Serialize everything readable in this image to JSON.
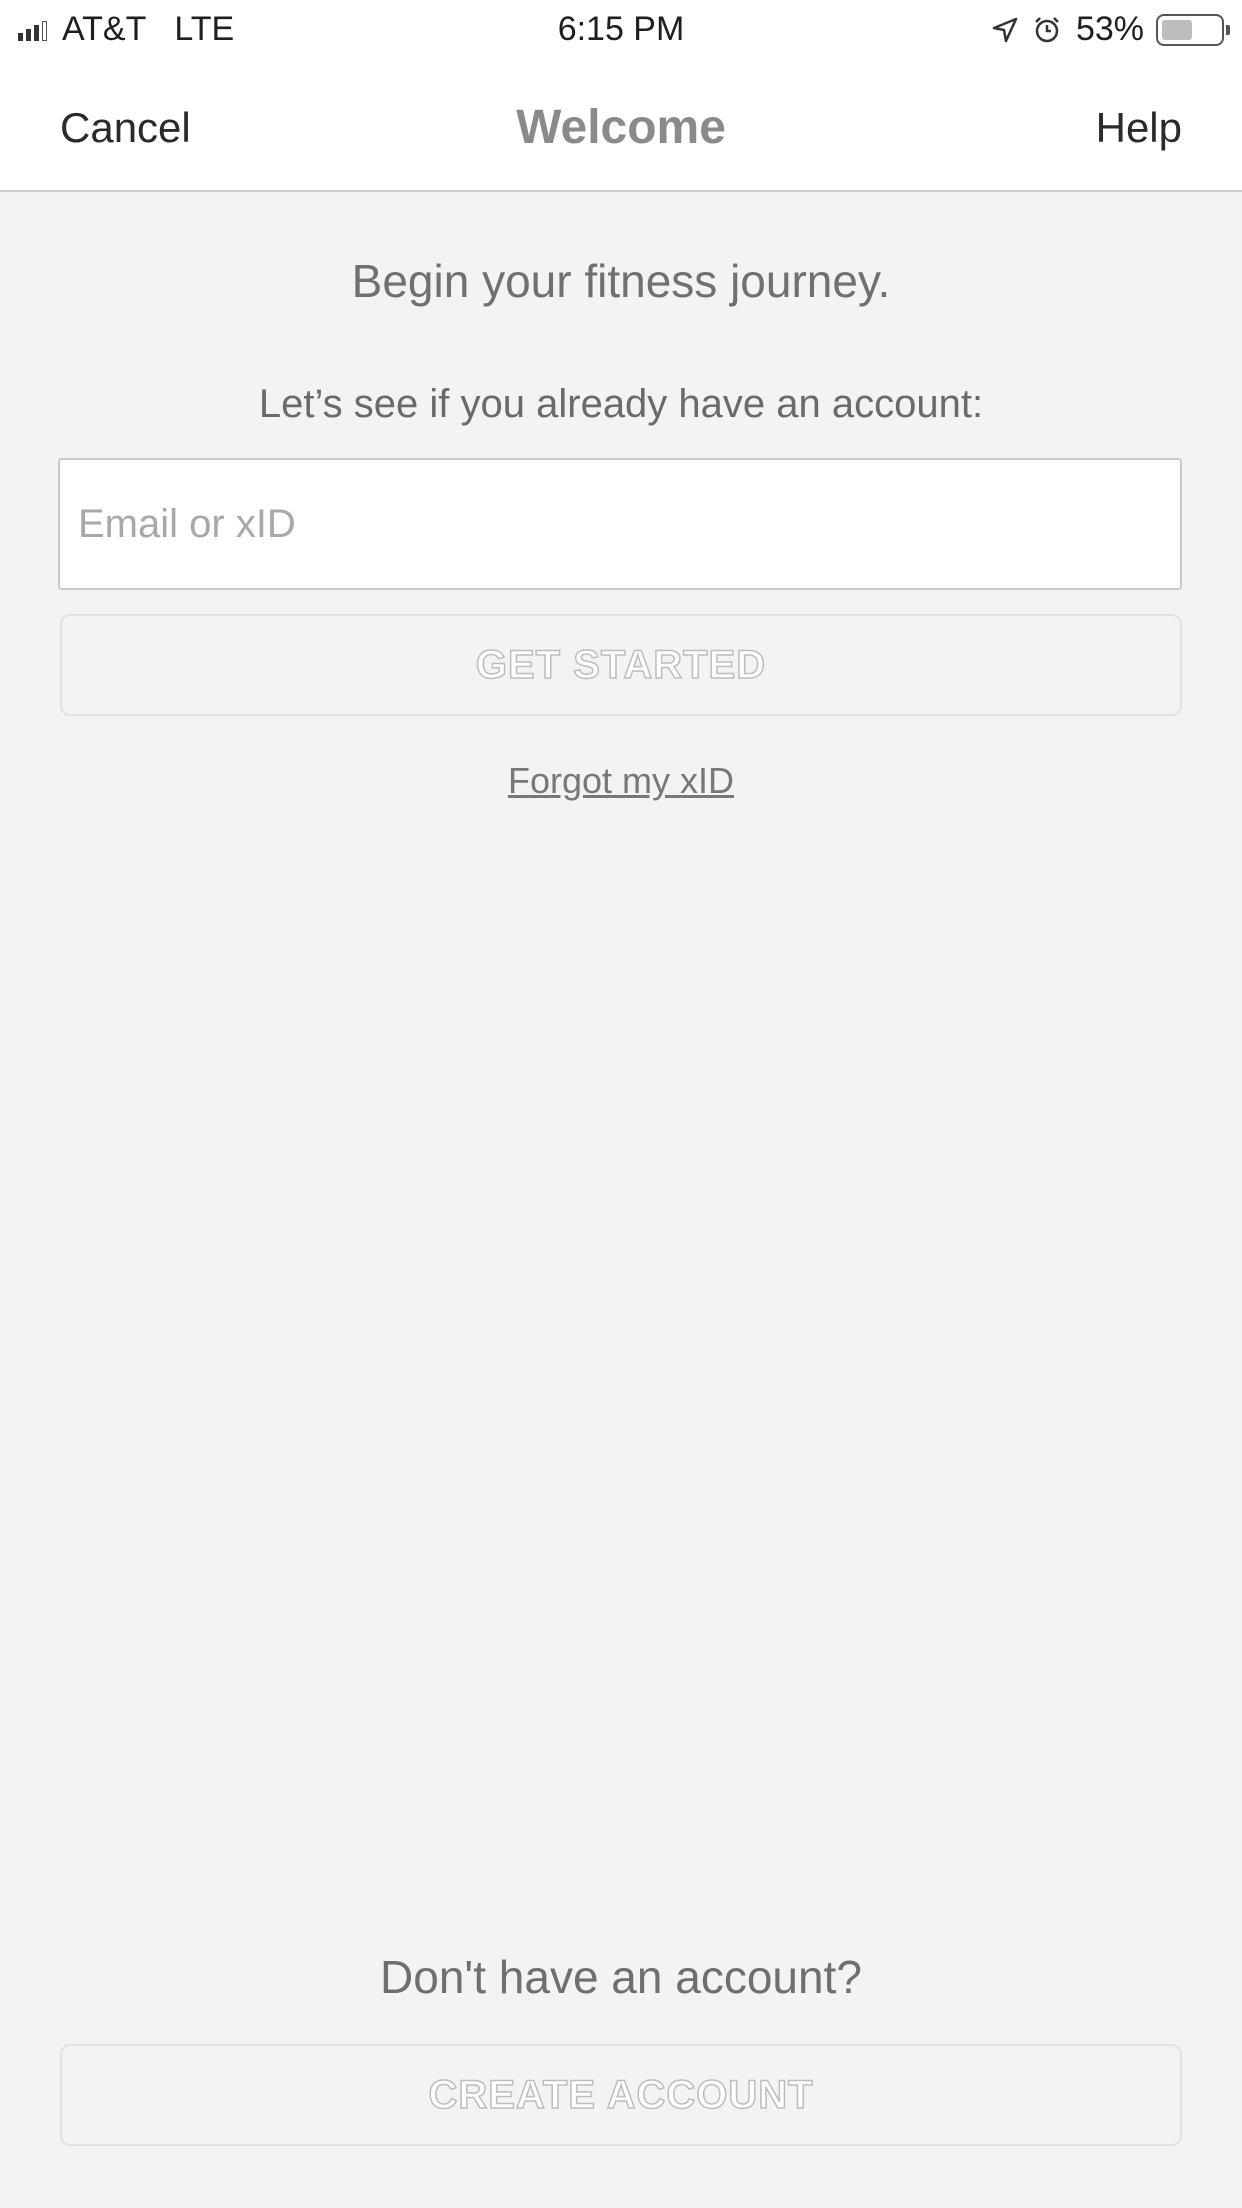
{
  "status_bar": {
    "carrier": "AT&T",
    "network": "LTE",
    "time": "6:15 PM",
    "battery_percent": "53%",
    "battery_level": 0.53,
    "icons": [
      "signal-icon",
      "location-arrow-icon",
      "alarm-icon",
      "battery-icon"
    ]
  },
  "nav": {
    "cancel_label": "Cancel",
    "title": "Welcome",
    "help_label": "Help"
  },
  "main": {
    "heading": "Begin your fitness journey.",
    "subheading": "Let’s see if you already have an account:",
    "email_placeholder": "Email or xID",
    "email_value": "",
    "get_started_label": "GET STARTED",
    "forgot_label": "Forgot my xID",
    "no_account_text": "Don't have an account?",
    "create_account_label": "CREATE ACCOUNT"
  }
}
